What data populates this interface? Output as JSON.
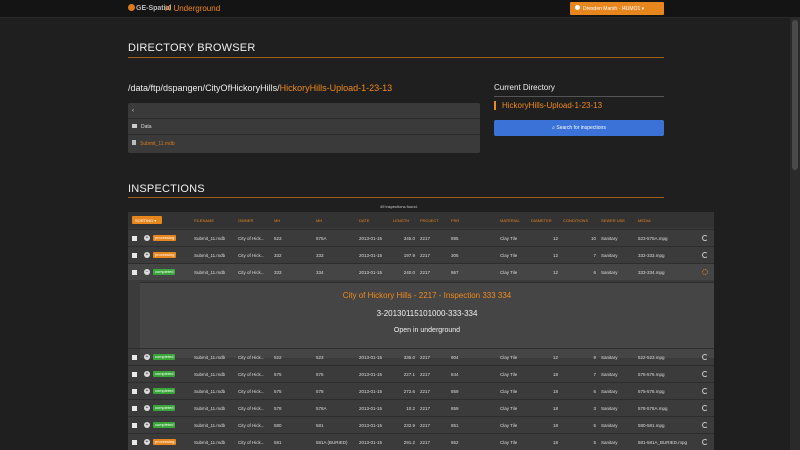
{
  "app": {
    "logo": "GE-Spatial",
    "name": "i4 Underground",
    "user_button": "Dresden Marsh · I4UMO1 ▾"
  },
  "directory_browser": {
    "heading": "DIRECTORY BROWSER",
    "path_prefix": "/data/ftp/dspangen/CityOfHickoryHills/",
    "path_current": "HickoryHills-Upload-1-23-13",
    "back_label": "‹",
    "entries": [
      {
        "name": "Data",
        "type": "folder"
      },
      {
        "name": "Submit_11.mdb",
        "type": "file"
      }
    ],
    "current_directory_title": "Current Directory",
    "current_directory_value": "HickoryHills-Upload-1-23-13",
    "search_button": "Search for inspections"
  },
  "inspections": {
    "heading": "INSPECTIONS",
    "found_text": "49 inspections found.",
    "sort_button": "SORTING ▾",
    "columns": [
      "FILENAME",
      "OWNER",
      "MH",
      "MH",
      "DATE",
      "LENGTH",
      "PROJECT",
      "PSR",
      "MATERIAL",
      "DIAMETER",
      "CONDITIONS",
      "SEWER USE",
      "MEDIA"
    ],
    "rows": [
      {
        "status": "processing",
        "filename": "Submit_11.mdb",
        "owner": "City of Hick...",
        "mh1": "523",
        "mh2": "575A",
        "date": "2013-01-15",
        "length": "345.0",
        "project": "2217",
        "psr": "895",
        "material": "Clay Tile",
        "diameter": "12",
        "conditions": "10",
        "use": "Sanitary",
        "media": "523-575A.mpg",
        "expanded": false
      },
      {
        "status": "processing",
        "filename": "Submit_11.mdb",
        "owner": "City of Hick...",
        "mh1": "332",
        "mh2": "333",
        "date": "2013-01-15",
        "length": "197.9",
        "project": "2217",
        "psr": "305",
        "material": "Clay Tile",
        "diameter": "12",
        "conditions": "7",
        "use": "Sanitary",
        "media": "332-333.mpg",
        "expanded": false
      },
      {
        "status": "completed",
        "filename": "Submit_11.mdb",
        "owner": "City of Hick...",
        "mh1": "333",
        "mh2": "334",
        "date": "2013-01-15",
        "length": "240.0",
        "project": "2217",
        "psr": "867",
        "material": "Clay Tile",
        "diameter": "12",
        "conditions": "6",
        "use": "Sanitary",
        "media": "333-334.mpg",
        "expanded": true
      },
      {
        "status": "completed",
        "filename": "Submit_11.mdb",
        "owner": "City of Hick...",
        "mh1": "522",
        "mh2": "523",
        "date": "2013-01-15",
        "length": "335.0",
        "project": "2217",
        "psr": "904",
        "material": "Clay Tile",
        "diameter": "12",
        "conditions": "9",
        "use": "Sanitary",
        "media": "522-523.mpg",
        "expanded": false
      },
      {
        "status": "completed",
        "filename": "Submit_11.mdb",
        "owner": "City of Hick...",
        "mh1": "575",
        "mh2": "576",
        "date": "2013-01-15",
        "length": "227.1",
        "project": "2217",
        "psr": "844",
        "material": "Clay Tile",
        "diameter": "18",
        "conditions": "7",
        "use": "Sanitary",
        "media": "575-576.mpg",
        "expanded": false
      },
      {
        "status": "completed",
        "filename": "Submit_11.mdb",
        "owner": "City of Hick...",
        "mh1": "575",
        "mh2": "578",
        "date": "2013-01-15",
        "length": "272.6",
        "project": "2217",
        "psr": "859",
        "material": "Clay Tile",
        "diameter": "18",
        "conditions": "6",
        "use": "Sanitary",
        "media": "575-578.mpg",
        "expanded": false
      },
      {
        "status": "completed",
        "filename": "Submit_11.mdb",
        "owner": "City of Hick...",
        "mh1": "578",
        "mh2": "578A",
        "date": "2013-01-15",
        "length": "10.2",
        "project": "2217",
        "psr": "859",
        "material": "Clay Tile",
        "diameter": "18",
        "conditions": "3",
        "use": "Sanitary",
        "media": "578-578A.mpg",
        "expanded": false
      },
      {
        "status": "completed",
        "filename": "Submit_11.mdb",
        "owner": "City of Hick...",
        "mh1": "580",
        "mh2": "581",
        "date": "2013-01-15",
        "length": "232.9",
        "project": "2217",
        "psr": "851",
        "material": "Clay Tile",
        "diameter": "18",
        "conditions": "5",
        "use": "Sanitary",
        "media": "580-581.mpg",
        "expanded": false
      },
      {
        "status": "processing",
        "filename": "Submit_11.mdb",
        "owner": "City of Hick...",
        "mh1": "581",
        "mh2": "581A (BURIED)",
        "date": "2013-01-15",
        "length": "291.2",
        "project": "2217",
        "psr": "862",
        "material": "Clay Tile",
        "diameter": "18",
        "conditions": "5",
        "use": "Sanitary",
        "media": "581-581A_BURIED.mpg",
        "expanded": false
      }
    ],
    "detail": {
      "title": "City of Hickory Hills - 2217 - Inspection 333 334",
      "code": "3-20130115101000-333-334",
      "open_label": "Open in underground"
    }
  },
  "colors": {
    "accent": "#f08a1c",
    "completed": "#3aa63a",
    "processing": "#e8861e",
    "search": "#3a72d8"
  }
}
